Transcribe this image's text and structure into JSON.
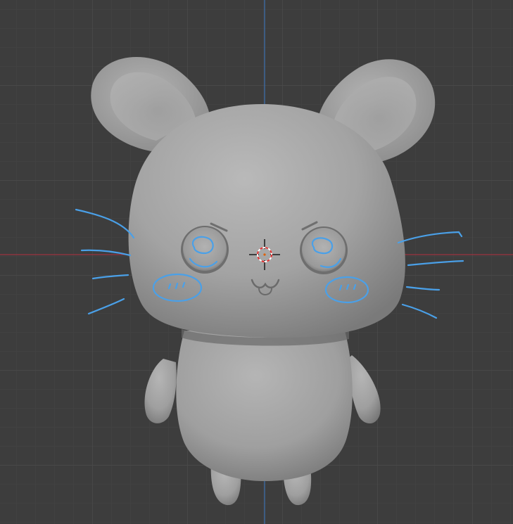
{
  "app": {
    "name": "3D viewport"
  },
  "viewport": {
    "background_color": "#3c3c3c",
    "minor_grid_color": "#464646",
    "major_grid_color": "#4e4e4e",
    "x_axis_color": "#9c3340",
    "z_axis_color": "#3e6ea8",
    "model_base_color": "#a8a8a8",
    "annotation_color": "#4aa0e8"
  },
  "scene": {
    "model": "mouse-character",
    "annotations": [
      "whiskers",
      "blush-cheeks",
      "eye-highlights"
    ],
    "icons": [
      "3d-cursor-icon"
    ]
  }
}
